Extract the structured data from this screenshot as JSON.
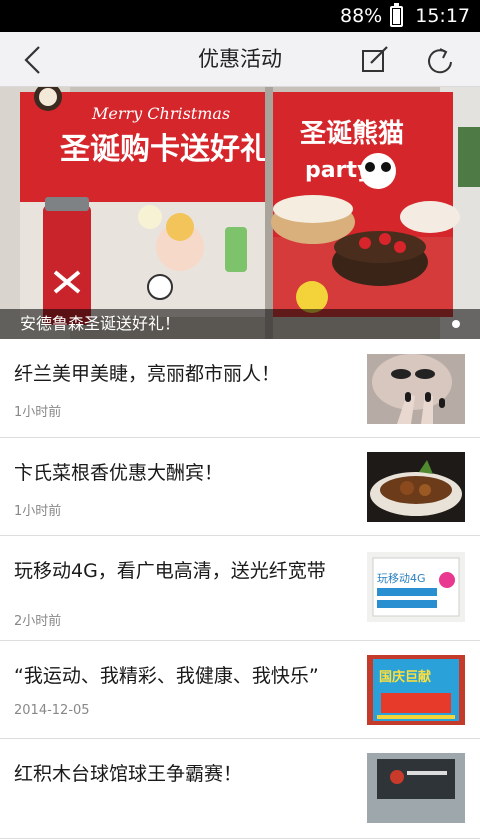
{
  "status_bar": {
    "battery": "88%",
    "time": "15:17",
    "battery_level": 0.88
  },
  "nav": {
    "title": "优惠活动"
  },
  "banner": {
    "caption": "安德鲁森圣诞送好礼！",
    "title_left": "圣诞购卡送好礼",
    "script_text": "Merry Christmas",
    "title_right": "圣诞熊猫",
    "party": "party"
  },
  "items": [
    {
      "title": "纤兰美甲美睫，亮丽都市丽人！",
      "time": "1小时前"
    },
    {
      "title": "卞氏菜根香优惠大酬宾！",
      "time": "1小时前"
    },
    {
      "title": "玩移动4G，看广电高清，送光纤宽带",
      "time": "2小时前",
      "thumb_text": "玩移动4G"
    },
    {
      "title": "“我运动、我精彩、我健康、我快乐”",
      "time": "2014-12-05",
      "thumb_text": "国庆巨献"
    },
    {
      "title": "红积木台球馆球王争霸赛！",
      "time": ""
    }
  ],
  "colors": {
    "nav_bg": "#f2f2f4",
    "status_bg": "#000000",
    "banner_red": "#d5262b"
  }
}
